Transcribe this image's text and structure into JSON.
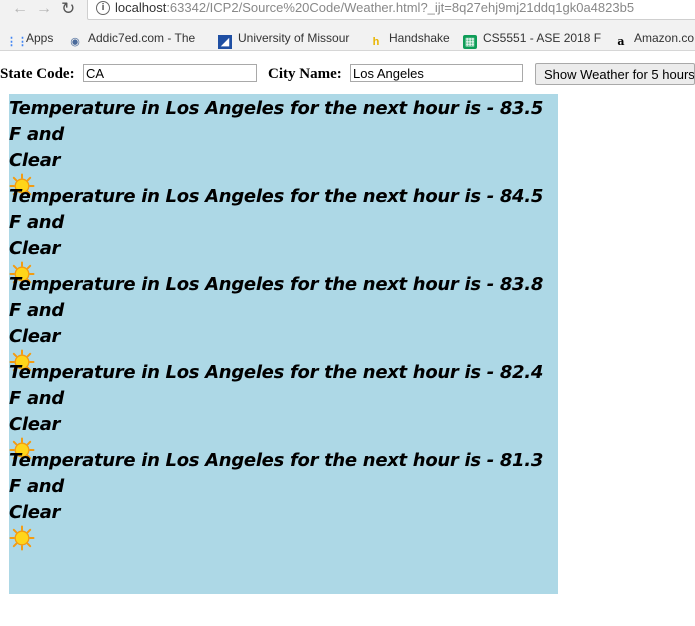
{
  "browser": {
    "url_host": "localhost",
    "url_rest": ":63342/ICP2/Source%20Code/Weather.html?_ijt=8q27ehj9mj21ddq1gk0a4823b5",
    "bookmarks": [
      {
        "label": "Apps",
        "icon": "apps-grid-icon"
      },
      {
        "label": "Addic7ed.com - The",
        "icon": "addic7ed-icon"
      },
      {
        "label": "University of Missour",
        "icon": "university-icon"
      },
      {
        "label": "Handshake",
        "icon": "handshake-icon"
      },
      {
        "label": "CS5551 - ASE 2018 F",
        "icon": "sheets-icon"
      },
      {
        "label": "Amazon.co",
        "icon": "amazon-icon"
      }
    ]
  },
  "form": {
    "state_label": "State Code:",
    "state_value": "CA",
    "city_label": "City Name:",
    "city_value": "Los Angeles",
    "submit_label": "Show Weather for 5 hours"
  },
  "forecast": {
    "entries": [
      {
        "line1": "Temperature in Los Angeles for the next hour is - 83.5 F and",
        "line2": "Clear",
        "icon": "sun-icon"
      },
      {
        "line1": "Temperature in Los Angeles for the next hour is - 84.5 F and",
        "line2": "Clear",
        "icon": "sun-icon"
      },
      {
        "line1": "Temperature in Los Angeles for the next hour is - 83.8 F and",
        "line2": "Clear",
        "icon": "sun-icon"
      },
      {
        "line1": "Temperature in Los Angeles for the next hour is - 82.4 F and",
        "line2": "Clear",
        "icon": "sun-icon"
      },
      {
        "line1": "Temperature in Los Angeles for the next hour is - 81.3 F and",
        "line2": "Clear",
        "icon": "sun-icon"
      }
    ],
    "panel_color": "#add8e6"
  }
}
